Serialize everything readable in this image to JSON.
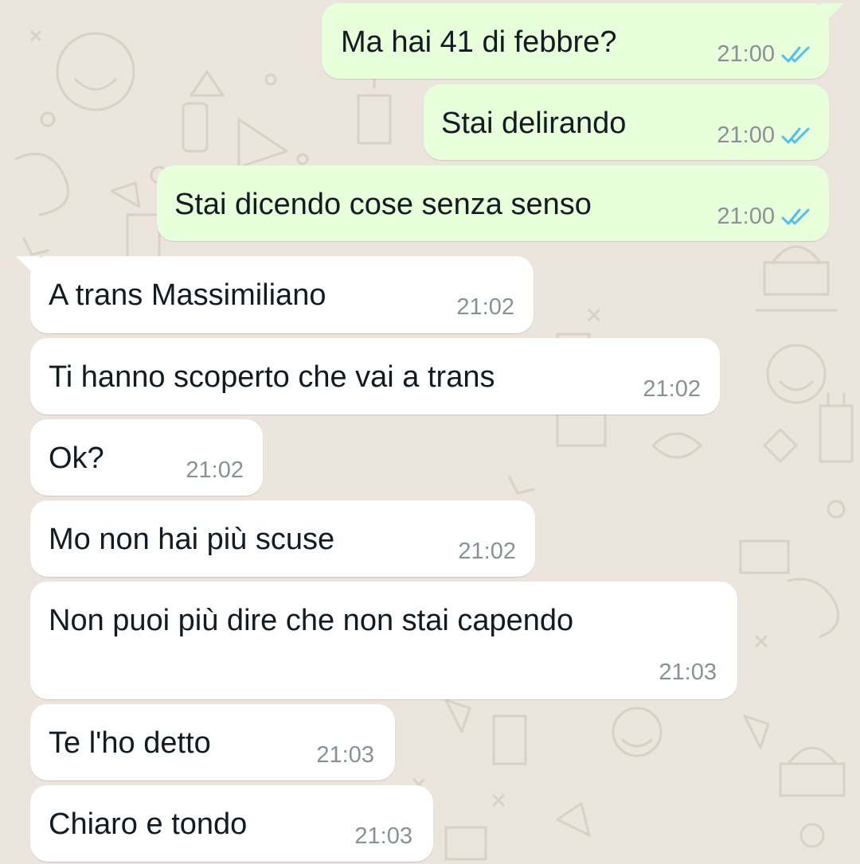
{
  "chat": {
    "messages": [
      {
        "direction": "outgoing",
        "text": "Ma hai 41 di febbre?",
        "time": "21:00",
        "status": "read",
        "status_icon": "double-check-icon"
      },
      {
        "direction": "outgoing",
        "text": "Stai delirando",
        "time": "21:00",
        "status": "read",
        "status_icon": "double-check-icon"
      },
      {
        "direction": "outgoing",
        "text": "Stai dicendo cose senza senso",
        "time": "21:00",
        "status": "read",
        "status_icon": "double-check-icon"
      },
      {
        "direction": "incoming",
        "text": "A trans Massimiliano",
        "time": "21:02"
      },
      {
        "direction": "incoming",
        "text": "Ti hanno scoperto che vai a trans",
        "time": "21:02"
      },
      {
        "direction": "incoming",
        "text": "Ok?",
        "time": "21:02"
      },
      {
        "direction": "incoming",
        "text": "Mo non hai più scuse",
        "time": "21:02"
      },
      {
        "direction": "incoming",
        "text": "Non puoi più dire che non stai capendo",
        "time": "21:03"
      },
      {
        "direction": "incoming",
        "text": "Te l'ho detto",
        "time": "21:03"
      },
      {
        "direction": "incoming",
        "text": "Chiaro e tondo",
        "time": "21:03"
      }
    ]
  },
  "colors": {
    "wallpaper": "#ece5dd",
    "outgoing_bubble": "#e7ffdb",
    "incoming_bubble": "#ffffff",
    "read_check": "#53bdeb",
    "timestamp": "#8b9094",
    "text": "#111b21"
  }
}
